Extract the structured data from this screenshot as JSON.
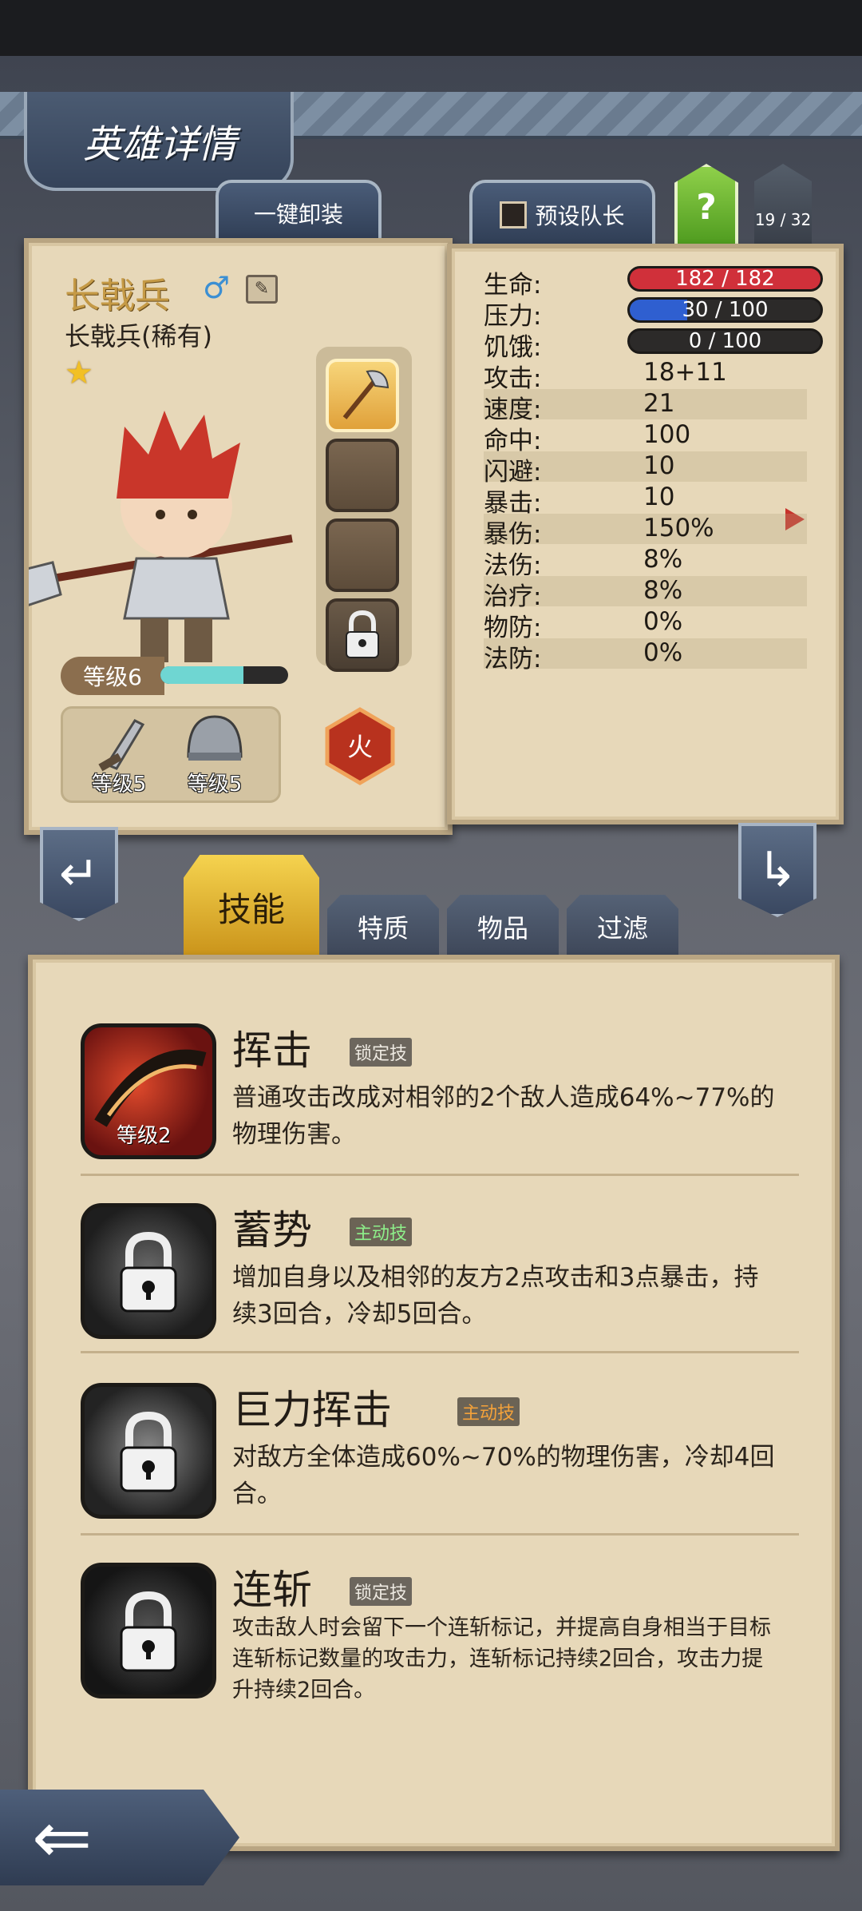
{
  "header": {
    "title": "英雄详情"
  },
  "toolbar": {
    "unequip_label": "一键卸装",
    "preset_leader_label": "预设队长",
    "help_label": "?",
    "roster_count": "19 / 32"
  },
  "hero": {
    "name": "长戟兵",
    "subtitle": "长戟兵(稀有)",
    "stars": 1,
    "level_label": "等级6",
    "xp_fraction": 0.65,
    "element_label": "火",
    "gear": [
      {
        "icon": "sword-icon",
        "label": "等级5"
      },
      {
        "icon": "helmet-icon",
        "label": "等级5"
      }
    ]
  },
  "stats": {
    "bars": [
      {
        "label": "生命:",
        "value": "182 / 182",
        "fraction": 1.0,
        "color": "#d0303a"
      },
      {
        "label": "压力:",
        "value": "30 / 100",
        "fraction": 0.3,
        "color": "#2f5fd0"
      },
      {
        "label": "饥饿:",
        "value": "0 / 100",
        "fraction": 0.0,
        "color": "#2f5fd0"
      }
    ],
    "rows": [
      {
        "label": "攻击:",
        "value": "18+11"
      },
      {
        "label": "速度:",
        "value": "21"
      },
      {
        "label": "命中:",
        "value": "100"
      },
      {
        "label": "闪避:",
        "value": "10"
      },
      {
        "label": "暴击:",
        "value": "10"
      },
      {
        "label": "暴伤:",
        "value": "150%"
      },
      {
        "label": "法伤:",
        "value": "8%"
      },
      {
        "label": "治疗:",
        "value": "8%"
      },
      {
        "label": "物防:",
        "value": "0%"
      },
      {
        "label": "法防:",
        "value": "0%"
      }
    ]
  },
  "tabs": [
    {
      "label": "技能",
      "active": true
    },
    {
      "label": "特质",
      "active": false
    },
    {
      "label": "物品",
      "active": false
    },
    {
      "label": "过滤",
      "active": false
    }
  ],
  "skills": [
    {
      "name": "挥击",
      "tag": "锁定技",
      "level": "等级2",
      "desc": "普通攻击改成对相邻的2个敌人造成64%~77%的物理伤害。"
    },
    {
      "name": "蓄势",
      "tag": "主动技",
      "desc": "增加自身以及相邻的友方2点攻击和3点暴击，持续3回合，冷却5回合。"
    },
    {
      "name": "巨力挥击",
      "tag": "主动技",
      "desc": "对敌方全体造成60%~70%的物理伤害，冷却4回合。"
    },
    {
      "name": "连斩",
      "tag": "锁定技",
      "desc": "攻击敌人时会留下一个连斩标记，并提高自身相当于目标连斩标记数量的攻击力，连斩标记持续2回合，攻击力提升持续2回合。"
    }
  ]
}
